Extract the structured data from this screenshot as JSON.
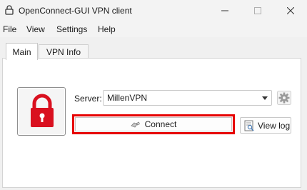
{
  "window": {
    "title": "OpenConnect-GUI VPN client"
  },
  "menu": {
    "items": [
      "File",
      "View",
      "Settings",
      "Help"
    ]
  },
  "tabs": [
    {
      "label": "Main",
      "active": true
    },
    {
      "label": "VPN Info",
      "active": false
    }
  ],
  "main": {
    "server_label": "Server:",
    "server_value": "MillenVPN",
    "connect_label": "Connect",
    "view_log_label": "View log",
    "status": "disconnected"
  },
  "colors": {
    "lock": "#d9101f",
    "highlight": "#e60000",
    "window_bg": "#f0f0f0"
  },
  "icons": {
    "app": "lock-icon",
    "settings": "gear-icon",
    "connect": "plug-icon",
    "view_log": "log-icon"
  }
}
